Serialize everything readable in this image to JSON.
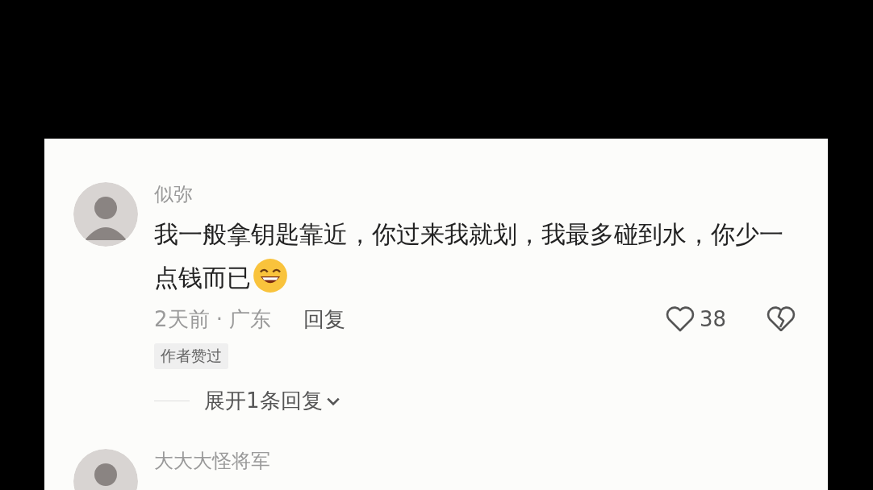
{
  "comments": [
    {
      "author": "似弥",
      "text": "我一般拿钥匙靠近，你过来我就划，我最多碰到水，你少一点钱而已",
      "time_location": "2天前 · 广东",
      "reply_label": "回复",
      "likes": "38",
      "badge": "作者赞过",
      "expand_replies": "展开1条回复"
    },
    {
      "author": "大大大怪将军"
    }
  ]
}
